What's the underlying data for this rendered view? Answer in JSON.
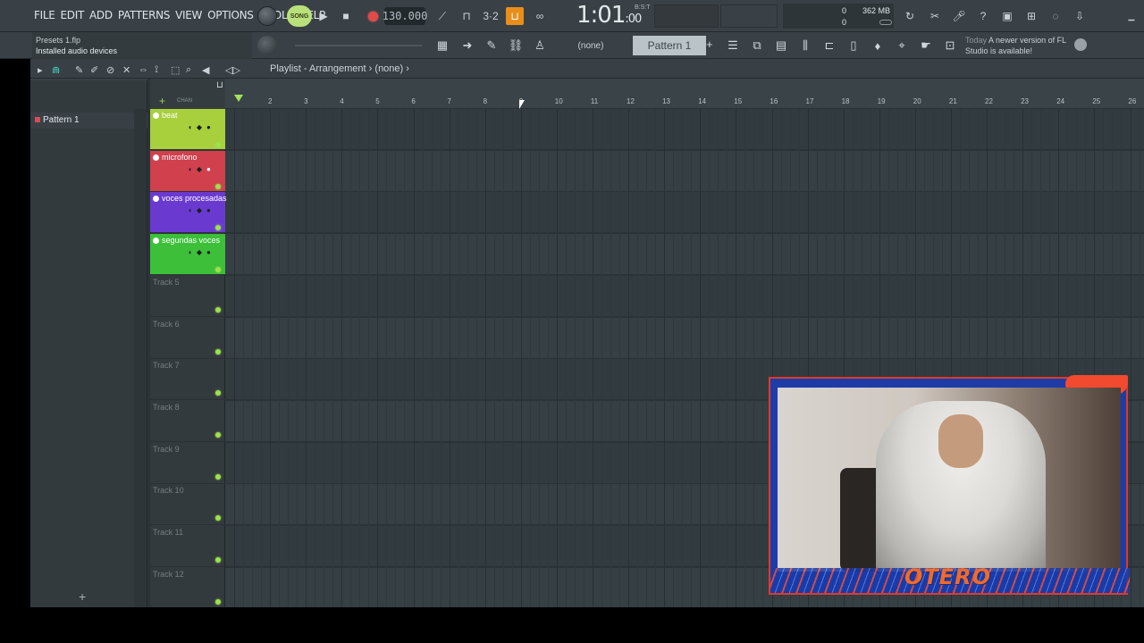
{
  "menu": [
    "FILE",
    "EDIT",
    "ADD",
    "PATTERNS",
    "VIEW",
    "OPTIONS",
    "TOOLS",
    "HELP"
  ],
  "transport": {
    "song_label": "SONG",
    "tempo": "130.000",
    "time": "1:01",
    "time_frac": ":00",
    "time_sub": "B:S:T"
  },
  "monitor": {
    "memory": "362 MB",
    "cpu_top": "0",
    "cpu_bottom": "0"
  },
  "hint": {
    "line1": "Presets 1.flp",
    "line2": "Installed audio devices"
  },
  "toolbar2": {
    "none_label": "(none)",
    "pattern_label": "Pattern 1"
  },
  "news": {
    "day": "Today",
    "text": "A newer version of FL Studio is available!"
  },
  "browser": {
    "pattern_item": "Pattern 1"
  },
  "playlist": {
    "title": "Playlist - Arrangement",
    "sep": "›",
    "target": "(none)",
    "chan_label": "CHAN"
  },
  "tracks": [
    {
      "name": "beat",
      "color": "#a8cf3c"
    },
    {
      "name": "microfono",
      "color": "#d0404d"
    },
    {
      "name": "voces procesadas",
      "color": "#6a3ad0"
    },
    {
      "name": "segundas voces",
      "color": "#3dbf3a"
    },
    {
      "name": "Track 5"
    },
    {
      "name": "Track 6"
    },
    {
      "name": "Track 7"
    },
    {
      "name": "Track 8"
    },
    {
      "name": "Track 9"
    },
    {
      "name": "Track 10"
    },
    {
      "name": "Track 11"
    },
    {
      "name": "Track 12"
    }
  ],
  "ruler": [
    "2",
    "3",
    "4",
    "5",
    "6",
    "7",
    "8",
    "9",
    "10",
    "11",
    "12",
    "13",
    "14",
    "15",
    "16",
    "17",
    "18",
    "19",
    "20",
    "21",
    "22",
    "23",
    "24",
    "25",
    "26"
  ],
  "webcam": {
    "logo": "OTERO"
  },
  "colors": {
    "accent": "#e88f1a",
    "led": "#9ee04d",
    "grid_a": "#323b40",
    "grid_b": "#353f44"
  }
}
